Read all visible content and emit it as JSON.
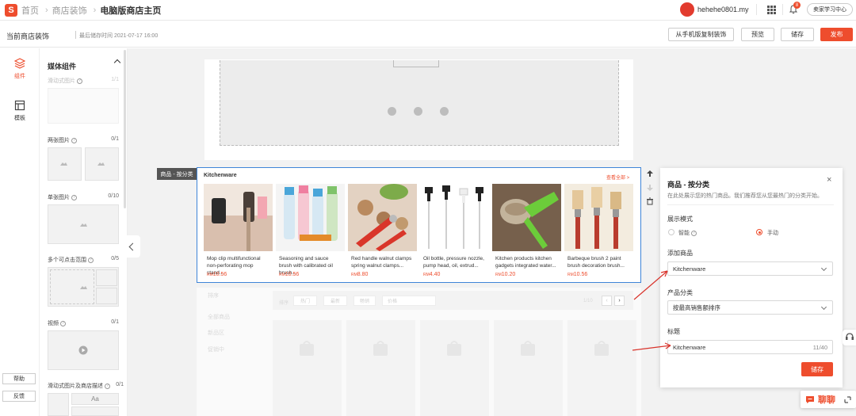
{
  "topbar": {
    "logo": "S",
    "breadcrumb": [
      "首页",
      "商店装饰",
      "电脑版商店主页"
    ],
    "username": "hehehe0801.my",
    "notif_count": "8",
    "learning_center": "卖家学习中心"
  },
  "subbar": {
    "title": "当前商店装饰",
    "last_saved": "最后储存时间 2021-07-17 16:00",
    "copy_from_mobile": "从手机版复制装饰",
    "preview": "预览",
    "save": "储存",
    "publish": "发布"
  },
  "rail": {
    "components": "组件",
    "templates": "模板",
    "help": "帮助",
    "feedback": "反馈"
  },
  "panel": {
    "title": "媒体组件",
    "items": [
      {
        "label": "滑动式图片",
        "count": "1/1"
      },
      {
        "label": "两张图片",
        "count": "0/1"
      },
      {
        "label": "单张图片",
        "count": "0/10"
      },
      {
        "label": "多个可点击范围",
        "count": "0/5"
      },
      {
        "label": "视频",
        "count": "0/1"
      },
      {
        "label": "滑动式图片及商店描述",
        "count": "0/1"
      }
    ],
    "text_glyph": "Aa"
  },
  "canvas": {
    "module_label": "商品 - 按分类",
    "product_section_title": "Kitchenware",
    "see_all": "查看全部 >",
    "currency": "RM",
    "products": [
      {
        "name": "Mop clip multifunctional non-perforating mop stand...",
        "price": "10.56"
      },
      {
        "name": "Seasoning and sauce brush with calibrated oil brush...",
        "price": "10.56"
      },
      {
        "name": "Red handle walnut clamps spring walnut clamps...",
        "price": "8.80"
      },
      {
        "name": "Oil bottle, pressure nozzle, pump head, oil, extrud...",
        "price": "4.40"
      },
      {
        "name": "Kitchen products kitchen gadgets integrated water...",
        "price": "10.20"
      },
      {
        "name": "Barbeque brush 2 paint brush decoration brush...",
        "price": "10.56"
      }
    ],
    "faded": {
      "side_items": [
        "排序",
        "全部商品",
        "新品区",
        "促销中"
      ],
      "sort_label": "排序",
      "chips": [
        "热门",
        "最新",
        "畅销",
        "价格"
      ],
      "page": "1/10"
    }
  },
  "settings": {
    "title": "商品 - 按分类",
    "description": "在此处展示您的热门商品。我们推荐您从您最热门的分类开始。",
    "display_mode_label": "展示模式",
    "mode_smart": "智能",
    "mode_manual": "手动",
    "add_products_label": "添加商品",
    "add_products_value": "Kitchenware",
    "product_category_label": "产品分类",
    "product_category_value": "按最高销售额排序",
    "title_label": "标题",
    "title_value": "Kitchenware",
    "title_counter": "11/40",
    "save": "储存"
  },
  "chat": {
    "label": "聊聊"
  },
  "colors": {
    "brand": "#ee4d2d",
    "selection": "#3f85d8",
    "annotation_arrow": "#d9332b"
  }
}
